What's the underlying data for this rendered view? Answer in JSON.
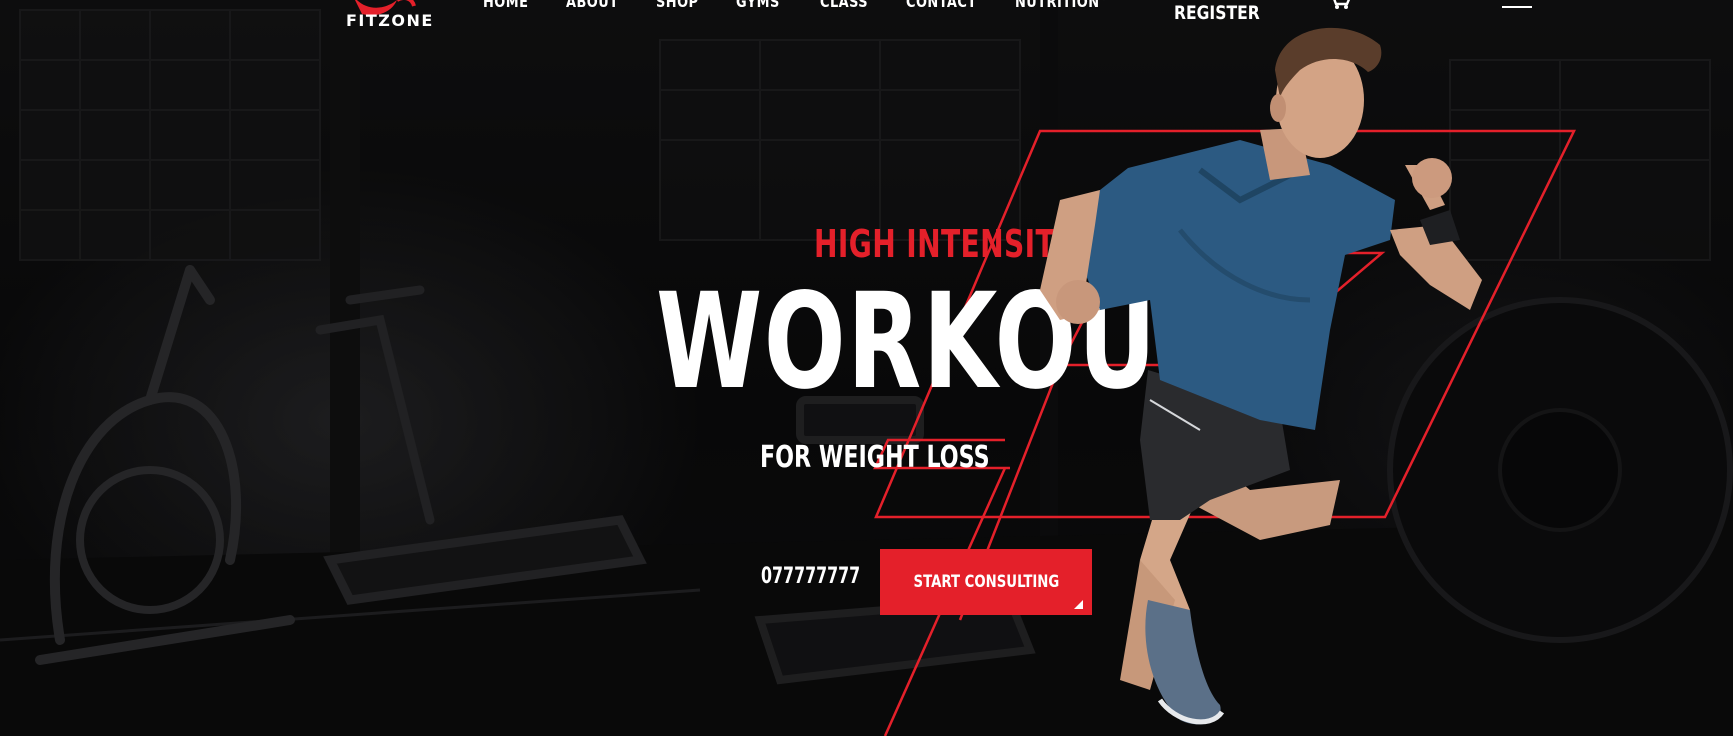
{
  "brand": {
    "name": "FITZONE"
  },
  "nav": {
    "items": [
      {
        "label": "HOME"
      },
      {
        "label": "ABOUT"
      },
      {
        "label": "SHOP"
      },
      {
        "label": "GYMS"
      },
      {
        "label": "CLASS"
      },
      {
        "label": "CONTACT"
      },
      {
        "label": "NUTRITION"
      }
    ],
    "register_label": "REGISTER"
  },
  "hero": {
    "kicker": "HIGH INTENSITY",
    "headline": "WORKOUT",
    "subline": "FOR WEIGHT LOSS",
    "phone": "077777777",
    "cta_label": "START CONSULTING"
  },
  "icons": {
    "logo": "fitzone-logo-mark",
    "nav_dropdown": "chevron-down-icon",
    "cart": "cart-icon",
    "menu": "hamburger-menu-icon"
  },
  "colors": {
    "accent": "#e4202a",
    "background": "#0b0b0c",
    "text": "#ffffff",
    "shirt": "#2c5a82"
  }
}
